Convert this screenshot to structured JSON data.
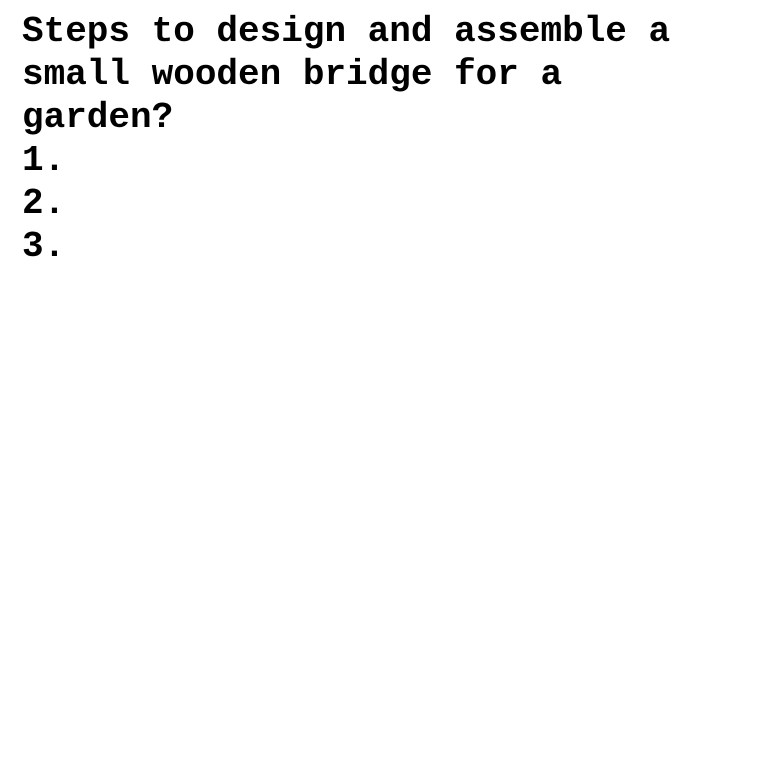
{
  "document": {
    "title_lines": [
      "Steps to design and assemble a",
      "small wooden bridge for a",
      "garden?"
    ],
    "list_items": [
      "1.",
      "2.",
      "3."
    ]
  }
}
